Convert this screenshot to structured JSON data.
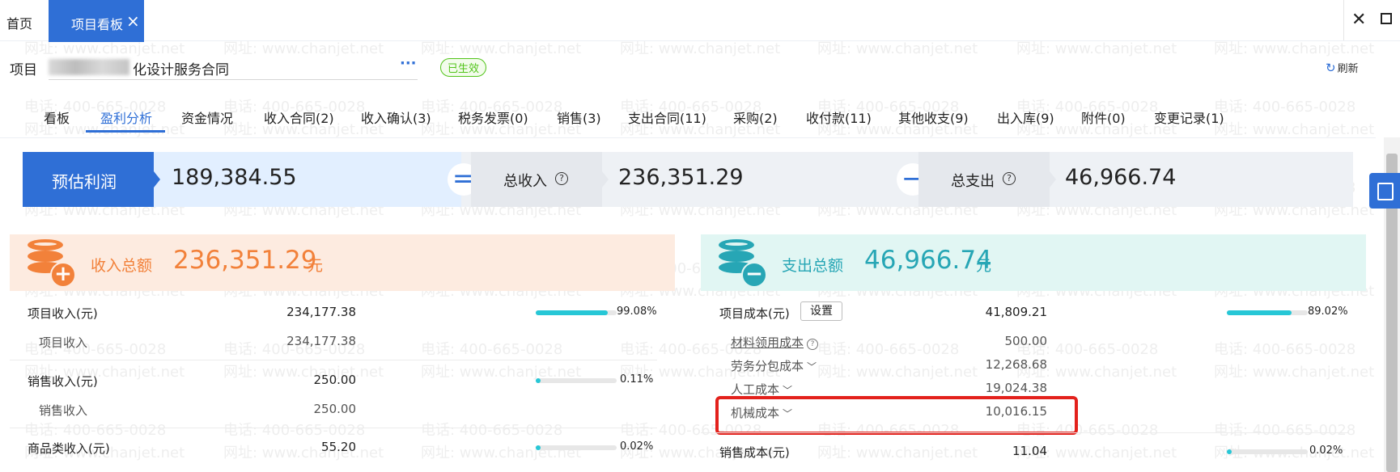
{
  "top_tabs": {
    "home": "首页",
    "active": "项目看板",
    "close_glyph": "×"
  },
  "project": {
    "label": "项目",
    "name_suffix": "化设计服务合同",
    "more": "···",
    "status": "已生效",
    "refresh": "刷新"
  },
  "sub_tabs": [
    {
      "label": "看板"
    },
    {
      "label": "盈利分析"
    },
    {
      "label": "资金情况"
    },
    {
      "label": "收入合同(2)"
    },
    {
      "label": "收入确认(3)"
    },
    {
      "label": "税务发票(0)"
    },
    {
      "label": "销售(3)"
    },
    {
      "label": "支出合同(11)"
    },
    {
      "label": "采购(2)"
    },
    {
      "label": "收付款(11)"
    },
    {
      "label": "其他收支(9)"
    },
    {
      "label": "出入库(9)"
    },
    {
      "label": "附件(0)"
    },
    {
      "label": "变更记录(1)"
    }
  ],
  "active_sub_tab": 1,
  "summary": {
    "profit_label": "预估利润",
    "profit_value": "189,384.55",
    "equals": "=",
    "income_label": "总收入",
    "income_value": "236,351.29",
    "minus": "−",
    "expense_label": "总支出",
    "expense_value": "46,966.74",
    "help_glyph": "?"
  },
  "income": {
    "title": "收入总额",
    "amount": "236,351.29",
    "unit": "元",
    "rows": [
      {
        "label": "项目收入(元)",
        "value": "234,177.38",
        "pct": "99.08%",
        "pct_frac": 0.9908,
        "sub_label": "项目收入",
        "sub_value": "234,177.38"
      },
      {
        "label": "销售收入(元)",
        "value": "250.00",
        "pct": "0.11%",
        "pct_frac": 0.0011,
        "sub_label": "销售收入",
        "sub_value": "250.00"
      },
      {
        "label": "商品类收入(元)",
        "value": "55.20",
        "pct": "0.02%",
        "pct_frac": 0.0002
      }
    ]
  },
  "expense": {
    "title": "支出总额",
    "amount": "46,966.74",
    "unit": "元",
    "project_cost_label": "项目成本(元)",
    "setting_button": "设置",
    "project_cost_value": "41,809.21",
    "project_cost_pct": "89.02%",
    "project_cost_frac": 0.8902,
    "sub_rows": [
      {
        "label": "材料领用成本",
        "value": "500.00"
      },
      {
        "label": "劳务分包成本",
        "value": "12,268.68"
      },
      {
        "label": "人工成本",
        "value": "19,024.38"
      },
      {
        "label": "机械成本",
        "value": "10,016.15"
      }
    ],
    "sales_cost_label": "销售成本(元)",
    "sales_cost_value": "11.04",
    "sales_cost_pct": "0.02%",
    "sales_cost_frac": 0.0002
  },
  "watermark": {
    "phone": "电话: 400-665-0028",
    "site": "网址: www.chanjet.net"
  },
  "colors": {
    "primary": "#2f6fd6",
    "income_accent": "#f2813a",
    "expense_accent": "#27a6b5",
    "highlight_box": "#e3211c"
  }
}
